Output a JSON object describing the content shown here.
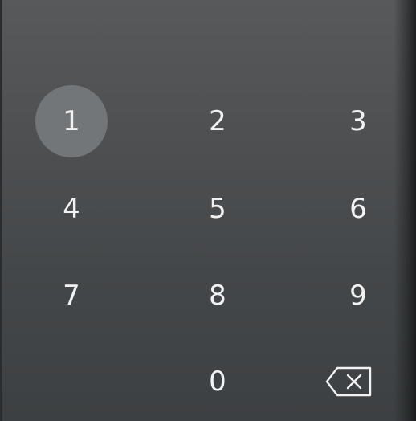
{
  "keypad": {
    "keys": [
      {
        "label": "1",
        "state": "pressed"
      },
      {
        "label": "2"
      },
      {
        "label": "3"
      },
      {
        "label": "4"
      },
      {
        "label": "5"
      },
      {
        "label": "6"
      },
      {
        "label": "7"
      },
      {
        "label": "8"
      },
      {
        "label": "9"
      },
      {
        "label": "0"
      }
    ],
    "backspace_icon": "backspace-icon",
    "pressed_key_color": "#737679",
    "text_color": "#f2f2f2"
  }
}
